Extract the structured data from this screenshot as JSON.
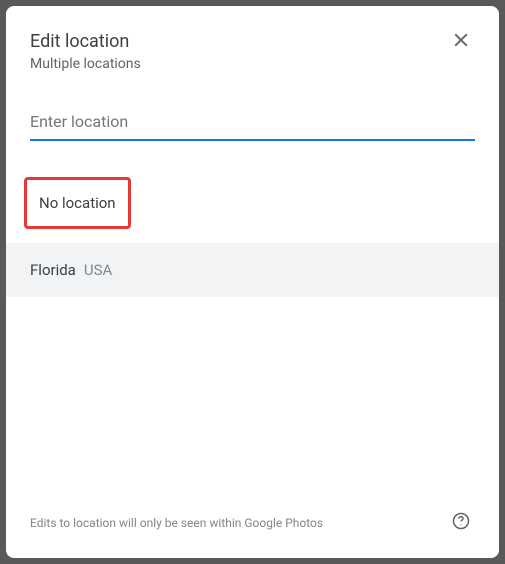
{
  "header": {
    "title": "Edit location",
    "subtitle": "Multiple locations"
  },
  "input": {
    "placeholder": "Enter location",
    "value": ""
  },
  "options": {
    "no_location_label": "No location",
    "suggestion": {
      "primary": "Florida",
      "secondary": "USA"
    }
  },
  "footer": {
    "note": "Edits to location will only be seen within Google Photos"
  }
}
